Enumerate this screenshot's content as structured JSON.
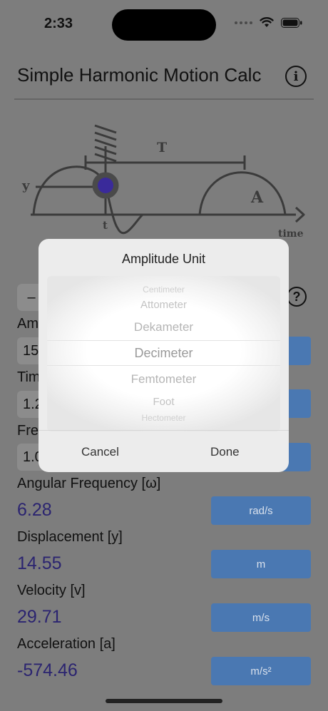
{
  "status": {
    "time": "2:33"
  },
  "header": {
    "title": "Simple Harmonic Motion Calc",
    "info_icon_glyph": "i"
  },
  "diagram": {
    "label_T": "T",
    "label_y": "y",
    "label_A": "A",
    "label_t": "t",
    "label_time": "time"
  },
  "controls": {
    "segment_glyph": "–",
    "help_glyph": "?"
  },
  "inputs": [
    {
      "label": "Am",
      "value": "15"
    },
    {
      "label": "Tim",
      "value": "1.2"
    },
    {
      "label": "Fre",
      "value": "1.0"
    }
  ],
  "outputs": [
    {
      "label": "Angular Frequency [ω]",
      "value": "6.28",
      "unit": "rad/s"
    },
    {
      "label": "Displacement [y]",
      "value": "14.55",
      "unit": "m"
    },
    {
      "label": "Velocity [v]",
      "value": "29.71",
      "unit": "m/s"
    },
    {
      "label": "Acceleration [a]",
      "value": "-574.46",
      "unit": "m/s²"
    }
  ],
  "modal": {
    "title": "Amplitude Unit",
    "options": [
      "Centimeter",
      "Attometer",
      "Dekameter",
      "Decimeter",
      "Femtometer",
      "Foot",
      "Hectometer"
    ],
    "selected": "Decimeter",
    "cancel_label": "Cancel",
    "done_label": "Done"
  },
  "colors": {
    "accent": "#4a78b2",
    "value_text": "#2b2470",
    "overlay": "#7d7d7d"
  }
}
